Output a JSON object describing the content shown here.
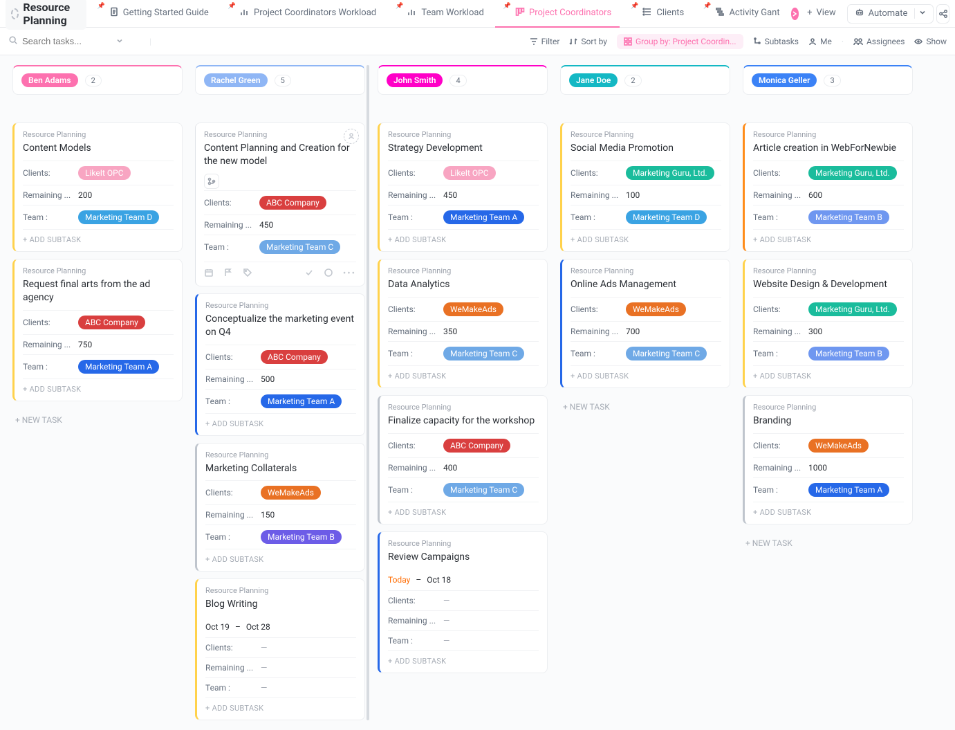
{
  "header": {
    "title": "Resource Planning",
    "tabs": [
      {
        "label": "Getting Started Guide",
        "icon": "doc"
      },
      {
        "label": "Project Coordinators Workload",
        "icon": "chart"
      },
      {
        "label": "Team Workload",
        "icon": "chart"
      },
      {
        "label": "Project Coordinators",
        "icon": "board",
        "active": true
      },
      {
        "label": "Clients",
        "icon": "list"
      },
      {
        "label": "Activity Gant",
        "icon": "gantt"
      }
    ],
    "add_view": "View",
    "automate": "Automate"
  },
  "toolbar": {
    "search_placeholder": "Search tasks...",
    "filter": "Filter",
    "sort": "Sort by",
    "group": "Group by: Project Coordin...",
    "subtasks": "Subtasks",
    "me": "Me",
    "assignees": "Assignees",
    "show": "Show"
  },
  "labels": {
    "project": "Resource Planning",
    "clients": "Clients:",
    "remaining": "Remaining ...",
    "team": "Team :",
    "add_subtask": "+ ADD SUBTASK",
    "new_task": "+ NEW TASK",
    "today": "Today"
  },
  "columns": [
    {
      "name": "Ben Adams",
      "count": "2",
      "header_color": "#fd71af",
      "cards": [
        {
          "title": "Content Models",
          "border": "#ffd24c",
          "client": {
            "text": "LikeIt OPC",
            "cls": "c-pink"
          },
          "remaining": "200",
          "team": {
            "text": "Marketing Team D",
            "cls": "c-blueD"
          }
        },
        {
          "title": "Request final arts from the ad agency",
          "border": "#ffd24c",
          "client": {
            "text": "ABC Company",
            "cls": "c-red"
          },
          "remaining": "750",
          "team": {
            "text": "Marketing Team A",
            "cls": "c-blueA"
          }
        }
      ],
      "show_new_task": true
    },
    {
      "name": "Rachel Green",
      "count": "5",
      "header_color": "#8fb6f5",
      "hover_card": {
        "title": "Content Planning and Creation for the new model",
        "client": {
          "text": "ABC Company",
          "cls": "c-red"
        },
        "remaining": "450",
        "team": {
          "text": "Marketing Team C",
          "cls": "c-blueC"
        }
      },
      "cards": [
        {
          "title": "Conceptualize the marketing event on Q4",
          "border": "#2668e8",
          "client": {
            "text": "ABC Company",
            "cls": "c-red"
          },
          "remaining": "500",
          "team": {
            "text": "Marketing Team A",
            "cls": "c-blueA"
          }
        },
        {
          "title": "Marketing Collaterals",
          "border": "#bfc5cd",
          "client": {
            "text": "WeMakeAds",
            "cls": "c-orange"
          },
          "remaining": "150",
          "team": {
            "text": "Marketing Team B",
            "cls": "c-purple"
          }
        },
        {
          "title": "Blog Writing",
          "border": "#ffd24c",
          "dates": {
            "start": "Oct 19",
            "end": "Oct 28"
          },
          "client": null,
          "remaining": null,
          "team": null
        }
      ]
    },
    {
      "name": "John Smith",
      "count": "4",
      "header_color": "#ff00c7",
      "cards": [
        {
          "title": "Strategy Development",
          "border": "#ffd24c",
          "client": {
            "text": "LikeIt OPC",
            "cls": "c-pink"
          },
          "remaining": "450",
          "team": {
            "text": "Marketing Team A",
            "cls": "c-blueA"
          }
        },
        {
          "title": "Data Analytics",
          "border": "#ffd24c",
          "client": {
            "text": "WeMakeAds",
            "cls": "c-orange"
          },
          "remaining": "350",
          "team": {
            "text": "Marketing Team C",
            "cls": "c-blueC"
          }
        },
        {
          "title": "Finalize capacity for the workshop",
          "border": "#bfc5cd",
          "client": {
            "text": "ABC Company",
            "cls": "c-red"
          },
          "remaining": "400",
          "team": {
            "text": "Marketing Team C",
            "cls": "c-blueC"
          }
        },
        {
          "title": "Review Campaigns",
          "border": "#2668e8",
          "dates": {
            "today": true,
            "end": "Oct 18"
          },
          "client": null,
          "remaining": null,
          "team": null
        }
      ]
    },
    {
      "name": "Jane Doe",
      "count": "2",
      "header_color": "#14b8c4",
      "cards": [
        {
          "title": "Social Media Promotion",
          "border": "#ffd24c",
          "client": {
            "text": "Marketing Guru, Ltd.",
            "cls": "c-teal"
          },
          "remaining": "100",
          "team": {
            "text": "Marketing Team D",
            "cls": "c-blueD"
          }
        },
        {
          "title": "Online Ads Management",
          "border": "#2668e8",
          "client": {
            "text": "WeMakeAds",
            "cls": "c-orange"
          },
          "remaining": "700",
          "team": {
            "text": "Marketing Team C",
            "cls": "c-blueC"
          }
        }
      ],
      "show_new_task": true
    },
    {
      "name": "Monica Geller",
      "count": "3",
      "header_color": "#3b82f6",
      "cards": [
        {
          "title": "Article creation in WebForNewbie",
          "border": "#ff8c1a",
          "client": {
            "text": "Marketing Guru, Ltd.",
            "cls": "c-teal"
          },
          "remaining": "600",
          "team": {
            "text": "Marketing Team B",
            "cls": "c-blueB"
          }
        },
        {
          "title": "Website Design & Development",
          "border": "#ffd24c",
          "client": {
            "text": "Marketing Guru, Ltd.",
            "cls": "c-teal"
          },
          "remaining": "300",
          "team": {
            "text": "Marketing Team B",
            "cls": "c-blueB"
          }
        },
        {
          "title": "Branding",
          "border": "#bfc5cd",
          "client": {
            "text": "WeMakeAds",
            "cls": "c-orange"
          },
          "remaining": "1000",
          "team": {
            "text": "Marketing Team A",
            "cls": "c-blueA"
          }
        }
      ],
      "show_new_task": true
    }
  ]
}
